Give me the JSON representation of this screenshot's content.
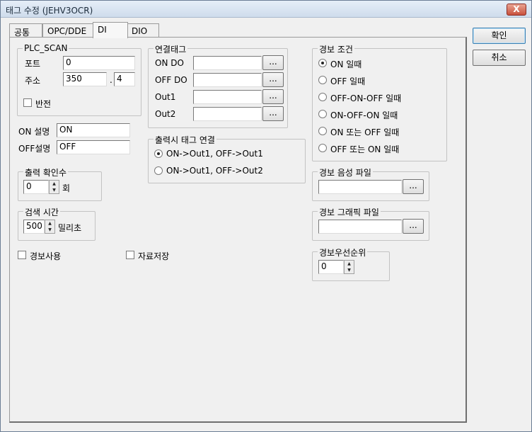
{
  "window": {
    "title": "태그 수정 (JEHV3OCR)",
    "close_glyph": "X"
  },
  "tabs": [
    {
      "label": "공통"
    },
    {
      "label": "OPC/DDE"
    },
    {
      "label": "DI"
    },
    {
      "label": "DIO"
    }
  ],
  "plc_scan": {
    "legend": "PLC_SCAN",
    "port_label": "포트",
    "port_value": "0",
    "address_label": "주소",
    "address_value": "350",
    "address_sep": ".",
    "address_bit": "4",
    "invert_label": "반전"
  },
  "on_desc": {
    "label": "ON 설명",
    "value": "ON"
  },
  "off_desc": {
    "label": "OFF설명",
    "value": "OFF"
  },
  "output_confirm": {
    "legend": "출력 확인수",
    "value": "0",
    "unit": "회"
  },
  "search_time": {
    "legend": "검색 시간",
    "value": "500",
    "unit": "밀리초"
  },
  "alarm_use_label": "경보사용",
  "data_save_label": "자료저장",
  "linked_tags": {
    "legend": "연결태그",
    "rows": [
      {
        "label": "ON DO",
        "value": "",
        "button": "..."
      },
      {
        "label": "OFF DO",
        "value": "",
        "button": "..."
      },
      {
        "label": "Out1",
        "value": "",
        "button": "..."
      },
      {
        "label": "Out2",
        "value": "",
        "button": "..."
      }
    ]
  },
  "output_link": {
    "legend": "출력시 태그 연결",
    "options": [
      "ON->Out1, OFF->Out1",
      "ON->Out1, OFF->Out2"
    ],
    "selected": 0
  },
  "alarm_condition": {
    "legend": "경보 조건",
    "options": [
      "ON 일때",
      "OFF 일때",
      "OFF-ON-OFF 일때",
      "ON-OFF-ON 일때",
      "ON 또는 OFF 일때",
      "OFF 또는 ON 일때"
    ],
    "selected": 0
  },
  "alarm_sound": {
    "legend": "경보 음성 파일",
    "value": "",
    "button": "..."
  },
  "alarm_graphic": {
    "legend": "경보 그래픽 파일",
    "value": "",
    "button": "..."
  },
  "alarm_priority": {
    "legend": "경보우선순위",
    "value": "0"
  },
  "buttons": {
    "ok": "확인",
    "cancel": "취소"
  }
}
